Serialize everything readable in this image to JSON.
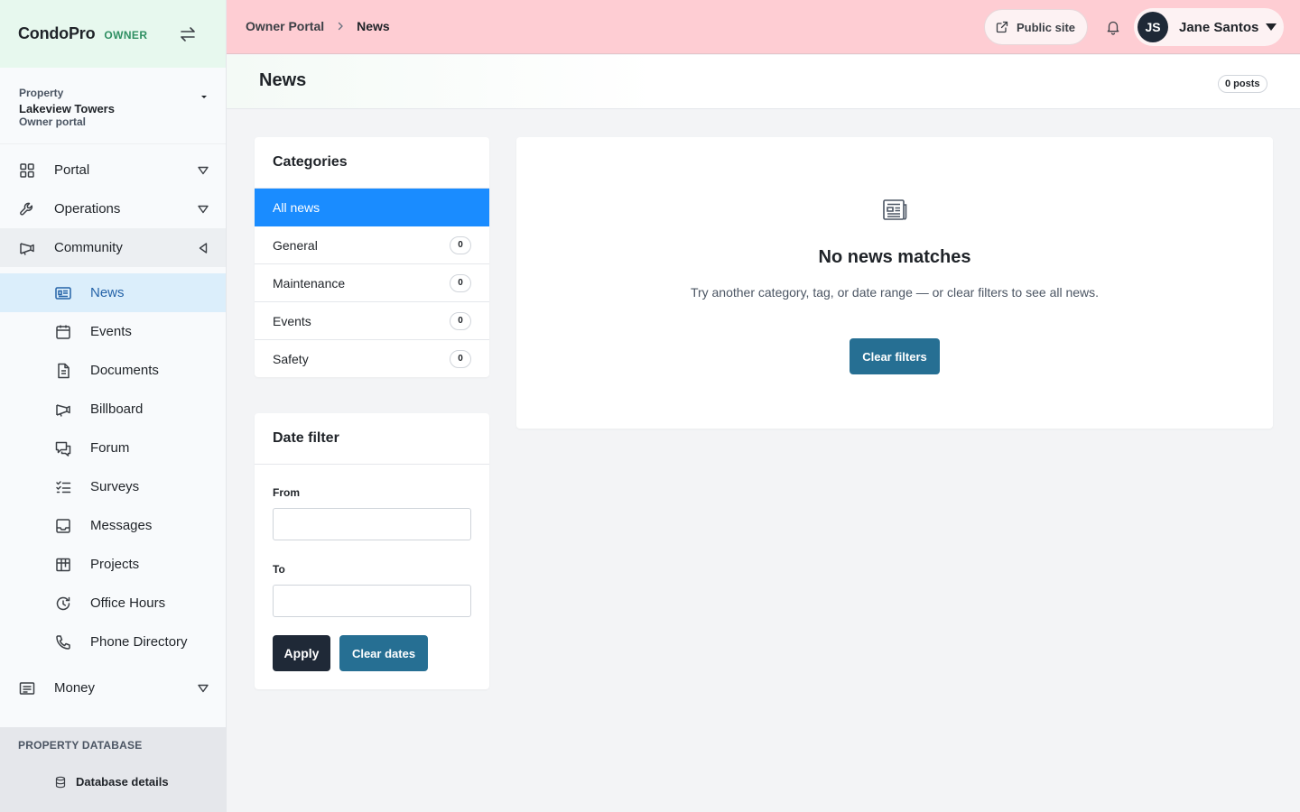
{
  "brand": {
    "name": "CondoPro",
    "role": "OWNER"
  },
  "property": {
    "label": "Property",
    "name": "Lakeview Towers",
    "sub": "Owner portal"
  },
  "nav": {
    "portal": "Portal",
    "operations": "Operations",
    "community": "Community",
    "community_items": [
      {
        "label": "News",
        "icon": "newspaper-icon"
      },
      {
        "label": "Events",
        "icon": "calendar-icon"
      },
      {
        "label": "Documents",
        "icon": "document-icon"
      },
      {
        "label": "Billboard",
        "icon": "megaphone-icon"
      },
      {
        "label": "Forum",
        "icon": "chat-icon"
      },
      {
        "label": "Surveys",
        "icon": "checklist-icon"
      },
      {
        "label": "Messages",
        "icon": "inbox-icon"
      },
      {
        "label": "Projects",
        "icon": "board-icon"
      },
      {
        "label": "Office Hours",
        "icon": "clock-icon"
      },
      {
        "label": "Phone Directory",
        "icon": "phone-icon"
      }
    ],
    "money": "Money"
  },
  "db_section": {
    "title": "PROPERTY DATABASE",
    "item": "Database details"
  },
  "topbar": {
    "crumb_root": "Owner Portal",
    "crumb_current": "News",
    "public_site": "Public site",
    "user_initials": "JS",
    "user_name": "Jane Santos"
  },
  "page": {
    "title": "News",
    "posts_badge": "0 posts"
  },
  "categories": {
    "title": "Categories",
    "items": [
      {
        "label": "All news",
        "count": null,
        "active": true
      },
      {
        "label": "General",
        "count": "0"
      },
      {
        "label": "Maintenance",
        "count": "0"
      },
      {
        "label": "Events",
        "count": "0"
      },
      {
        "label": "Safety",
        "count": "0"
      }
    ]
  },
  "date_filter": {
    "title": "Date filter",
    "from_label": "From",
    "from_value": "",
    "to_label": "To",
    "to_value": "",
    "apply": "Apply",
    "clear": "Clear dates"
  },
  "empty": {
    "title": "No news matches",
    "description": "Try another category, tag, or date range — or clear filters to see all news.",
    "button": "Clear filters"
  },
  "colors": {
    "active_blue": "#1a8cff",
    "teal_button": "#266f93",
    "topbar": "#fecdd3",
    "brand_bg": "#e7f8ee"
  }
}
